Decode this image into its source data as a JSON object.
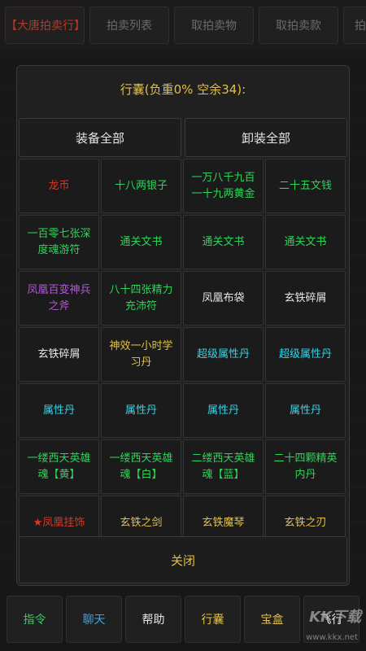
{
  "top_tabs": [
    {
      "label": "【大唐拍卖行】",
      "active": true
    },
    {
      "label": "拍卖列表",
      "active": false
    },
    {
      "label": "取拍卖物",
      "active": false
    },
    {
      "label": "取拍卖款",
      "active": false
    },
    {
      "label": "拍",
      "active": false
    }
  ],
  "dialog": {
    "title": "行囊(负重0% 空余34):",
    "equip_all": "装备全部",
    "unequip_all": "卸装全部",
    "close": "关闭",
    "items": [
      {
        "label": "龙币",
        "color": "#d23a2a"
      },
      {
        "label": "十八两银子",
        "color": "#2fd35a"
      },
      {
        "label": "一万八千九百一十九两黄金",
        "color": "#2fd35a"
      },
      {
        "label": "二十五文钱",
        "color": "#2fd35a"
      },
      {
        "label": "一百零七张深度魂游符",
        "color": "#2fd35a"
      },
      {
        "label": "通关文书",
        "color": "#2fd35a"
      },
      {
        "label": "通关文书",
        "color": "#2fd35a"
      },
      {
        "label": "通关文书",
        "color": "#2fd35a"
      },
      {
        "label": "凤凰百变神兵之斧",
        "color": "#b15ad6"
      },
      {
        "label": "八十四张精力充沛符",
        "color": "#2fd35a"
      },
      {
        "label": "凤凰布袋",
        "color": "#e6e6e6"
      },
      {
        "label": "玄铁碎屑",
        "color": "#e6e6e6"
      },
      {
        "label": "玄铁碎屑",
        "color": "#e6e6e6"
      },
      {
        "label": "神效一小时学习丹",
        "color": "#e3c043"
      },
      {
        "label": "超级属性丹",
        "color": "#35d4e8"
      },
      {
        "label": "超级属性丹",
        "color": "#35d4e8"
      },
      {
        "label": "属性丹",
        "color": "#35d4e8"
      },
      {
        "label": "属性丹",
        "color": "#35d4e8"
      },
      {
        "label": "属性丹",
        "color": "#35d4e8"
      },
      {
        "label": "属性丹",
        "color": "#35d4e8"
      },
      {
        "label": "一缕西天英雄魂【黄】",
        "color": "#2fd35a"
      },
      {
        "label": "一缕西天英雄魂【白】",
        "color": "#2fd35a"
      },
      {
        "label": "二缕西天英雄魂【蓝】",
        "color": "#2fd35a"
      },
      {
        "label": "二十四颗精英内丹",
        "color": "#2fd35a"
      },
      {
        "label": "★凤凰挂饰",
        "color": "#d23a2a"
      },
      {
        "label": "玄铁之剑",
        "color": "#e3c043"
      },
      {
        "label": "玄铁魔琴",
        "color": "#e3c043"
      },
      {
        "label": "玄铁之刃",
        "color": "#e3c043"
      }
    ]
  },
  "bottom_tabs": [
    {
      "label": "指令",
      "color": "#2fd35a"
    },
    {
      "label": "聊天",
      "color": "#35a6e8"
    },
    {
      "label": "帮助",
      "color": "#e6e6e6"
    },
    {
      "label": "行囊",
      "color": "#e3c043"
    },
    {
      "label": "宝盒",
      "color": "#e3c043"
    },
    {
      "label": "飞行",
      "color": "#e6e6e6"
    }
  ],
  "watermark": {
    "brand": "KK下载",
    "url": "www.kkx.net"
  }
}
